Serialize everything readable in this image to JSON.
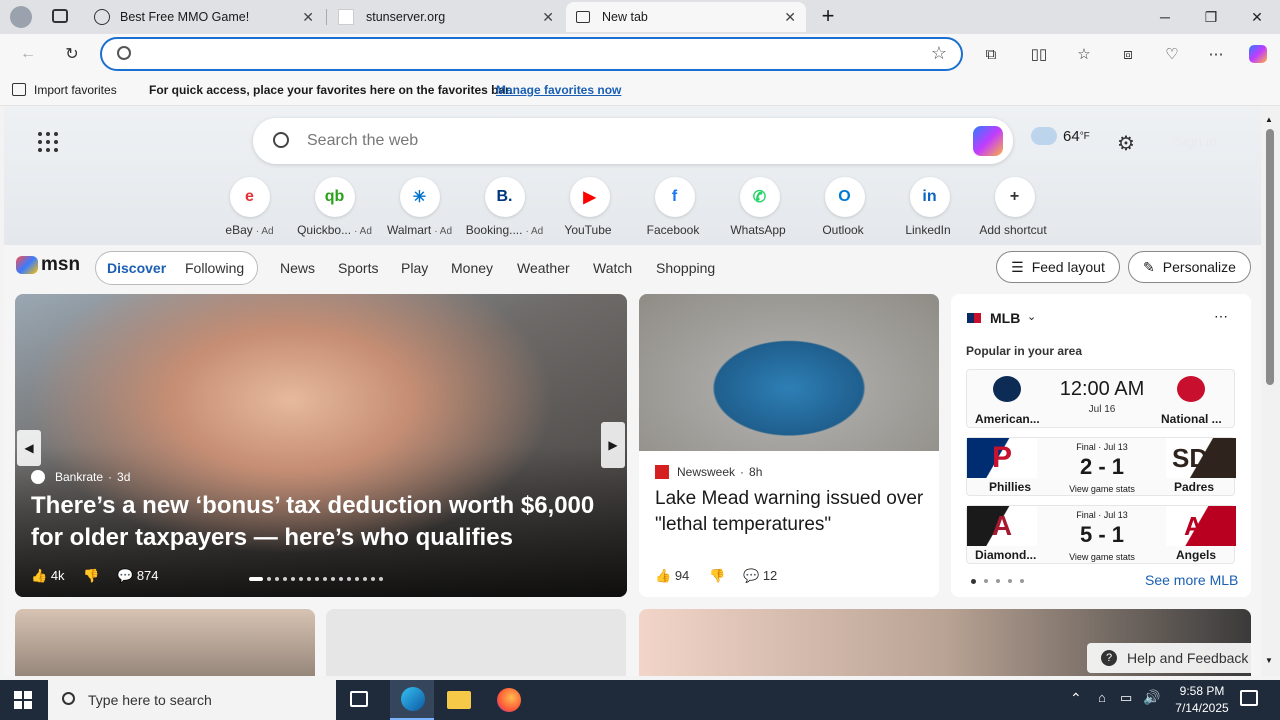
{
  "tabs": [
    {
      "title": "Best Free MMO Game!",
      "active": false
    },
    {
      "title": "stunserver.org",
      "active": false
    },
    {
      "title": "New tab",
      "active": true
    }
  ],
  "address": {
    "value": "",
    "placeholder": ""
  },
  "favbar": {
    "import_label": "Import favorites",
    "hint": "For quick access, place your favorites here on the favorites bar.",
    "manage_link": "Manage favorites now"
  },
  "search": {
    "placeholder": "Search the web"
  },
  "weather": {
    "temp": "64",
    "unit": "°F"
  },
  "signin": "Sign in",
  "shortcuts": [
    {
      "label": "eBay",
      "ad": "· Ad",
      "color": "#e53238",
      "glyph": "e"
    },
    {
      "label": "Quickbo...",
      "ad": "· Ad",
      "color": "#2ca01c",
      "glyph": "qb"
    },
    {
      "label": "Walmart",
      "ad": "· Ad",
      "color": "#0071ce",
      "glyph": "✳"
    },
    {
      "label": "Booking....",
      "ad": "· Ad",
      "color": "#003580",
      "glyph": "B."
    },
    {
      "label": "YouTube",
      "ad": "",
      "color": "#ff0000",
      "glyph": "▶"
    },
    {
      "label": "Facebook",
      "ad": "",
      "color": "#1877f2",
      "glyph": "f"
    },
    {
      "label": "WhatsApp",
      "ad": "",
      "color": "#25d366",
      "glyph": "✆"
    },
    {
      "label": "Outlook",
      "ad": "",
      "color": "#0078d4",
      "glyph": "O"
    },
    {
      "label": "LinkedIn",
      "ad": "",
      "color": "#0a66c2",
      "glyph": "in"
    },
    {
      "label": "Add shortcut",
      "ad": "",
      "color": "#333",
      "glyph": "+"
    }
  ],
  "msn": {
    "logo": "msn",
    "tabs": [
      "Discover",
      "Following"
    ],
    "nav": [
      "News",
      "Sports",
      "Play",
      "Money",
      "Weather",
      "Watch",
      "Shopping"
    ],
    "feed_layout": "Feed layout",
    "personalize": "Personalize"
  },
  "hero": {
    "source": "Bankrate",
    "age": "3d",
    "headline": "There’s a new ‘bonus’ tax deduction worth $6,000 for older taxpayers — here’s who qualifies",
    "likes": "4k",
    "comments": "874"
  },
  "story2": {
    "source": "Newsweek",
    "age": "8h",
    "headline": "Lake Mead warning issued over \"lethal temperatures\"",
    "likes": "94",
    "comments": "12"
  },
  "mlb": {
    "title": "MLB",
    "subtitle": "Popular in your area",
    "games": [
      {
        "status": "",
        "time": "12:00 AM",
        "date": "Jul 16",
        "home": "American...",
        "away": "National ...",
        "score": "",
        "link": ""
      },
      {
        "status": "Final · Jul 13",
        "time": "",
        "date": "",
        "home": "Phillies",
        "away": "Padres",
        "score": "2 - 1",
        "link": "View game stats"
      },
      {
        "status": "Final · Jul 13",
        "time": "",
        "date": "",
        "home": "Diamond...",
        "away": "Angels",
        "score": "5 - 1",
        "link": "View game stats"
      }
    ],
    "see_more": "See more MLB"
  },
  "help": "Help and Feedback",
  "taskbar": {
    "search_placeholder": "Type here to search",
    "time": "9:58 PM",
    "date": "7/14/2025"
  }
}
